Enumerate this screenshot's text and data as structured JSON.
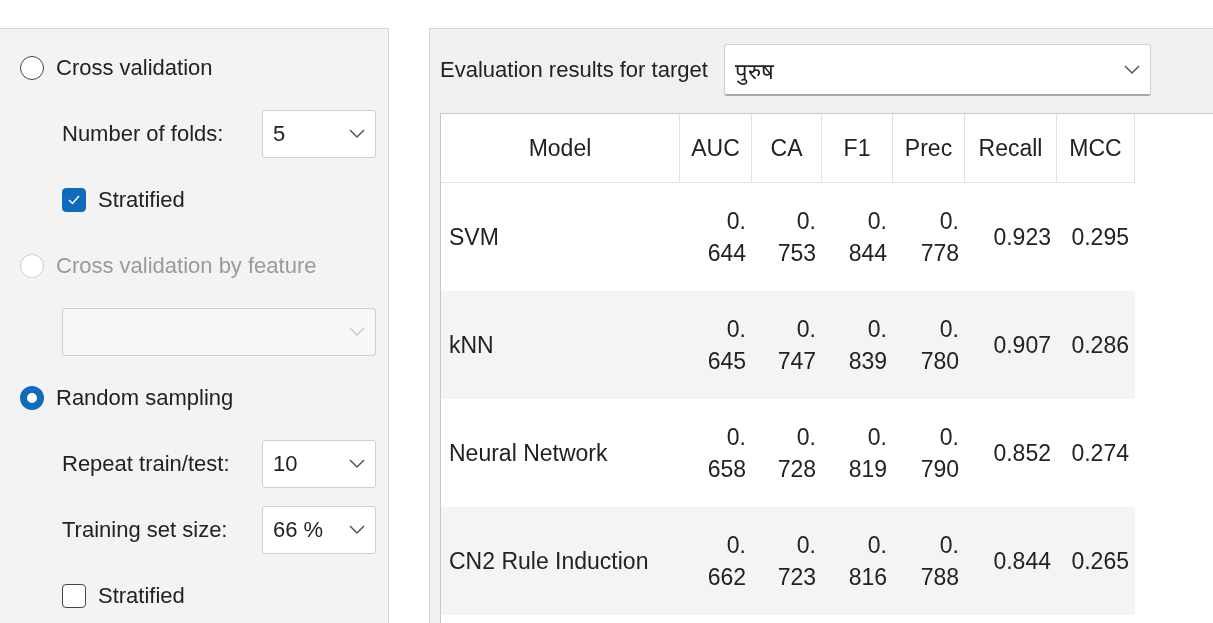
{
  "sampling_options": [
    {
      "label": "Cross validation",
      "selected": false,
      "disabled": false,
      "children": [
        {
          "kind": "dropdown",
          "label": "Number of folds:",
          "value": "5",
          "disabled": false
        },
        {
          "kind": "checkbox",
          "label": "Stratified",
          "checked": true
        }
      ]
    },
    {
      "label": "Cross validation by feature",
      "selected": false,
      "disabled": true,
      "children": [
        {
          "kind": "dropdown",
          "disabled": true
        }
      ]
    },
    {
      "label": "Random sampling",
      "selected": true,
      "disabled": false,
      "children": [
        {
          "kind": "dropdown",
          "label": "Repeat train/test:",
          "value": "10",
          "disabled": false
        },
        {
          "kind": "dropdown",
          "label": "Training set size:",
          "value": "66 %",
          "disabled": false
        },
        {
          "kind": "checkbox",
          "label": "Stratified",
          "checked": false
        }
      ]
    }
  ],
  "results": {
    "target_label": "Evaluation results for target",
    "target_value": "पुरुष",
    "columns": [
      "Model",
      "AUC",
      "CA",
      "F1",
      "Prec",
      "Recall",
      "MCC"
    ],
    "rows": [
      {
        "cells": [
          "SVM",
          "0.644",
          "0.753",
          "0.844",
          "0.778",
          "0.923",
          "0.295"
        ]
      },
      {
        "cells": [
          "kNN",
          "0.645",
          "0.747",
          "0.839",
          "0.780",
          "0.907",
          "0.286"
        ]
      },
      {
        "cells": [
          "Neural Network",
          "0.658",
          "0.728",
          "0.819",
          "0.790",
          "0.852",
          "0.274"
        ]
      },
      {
        "cells": [
          "CN2 Rule Induction",
          "0.662",
          "0.723",
          "0.816",
          "0.788",
          "0.844",
          "0.265"
        ]
      }
    ]
  }
}
